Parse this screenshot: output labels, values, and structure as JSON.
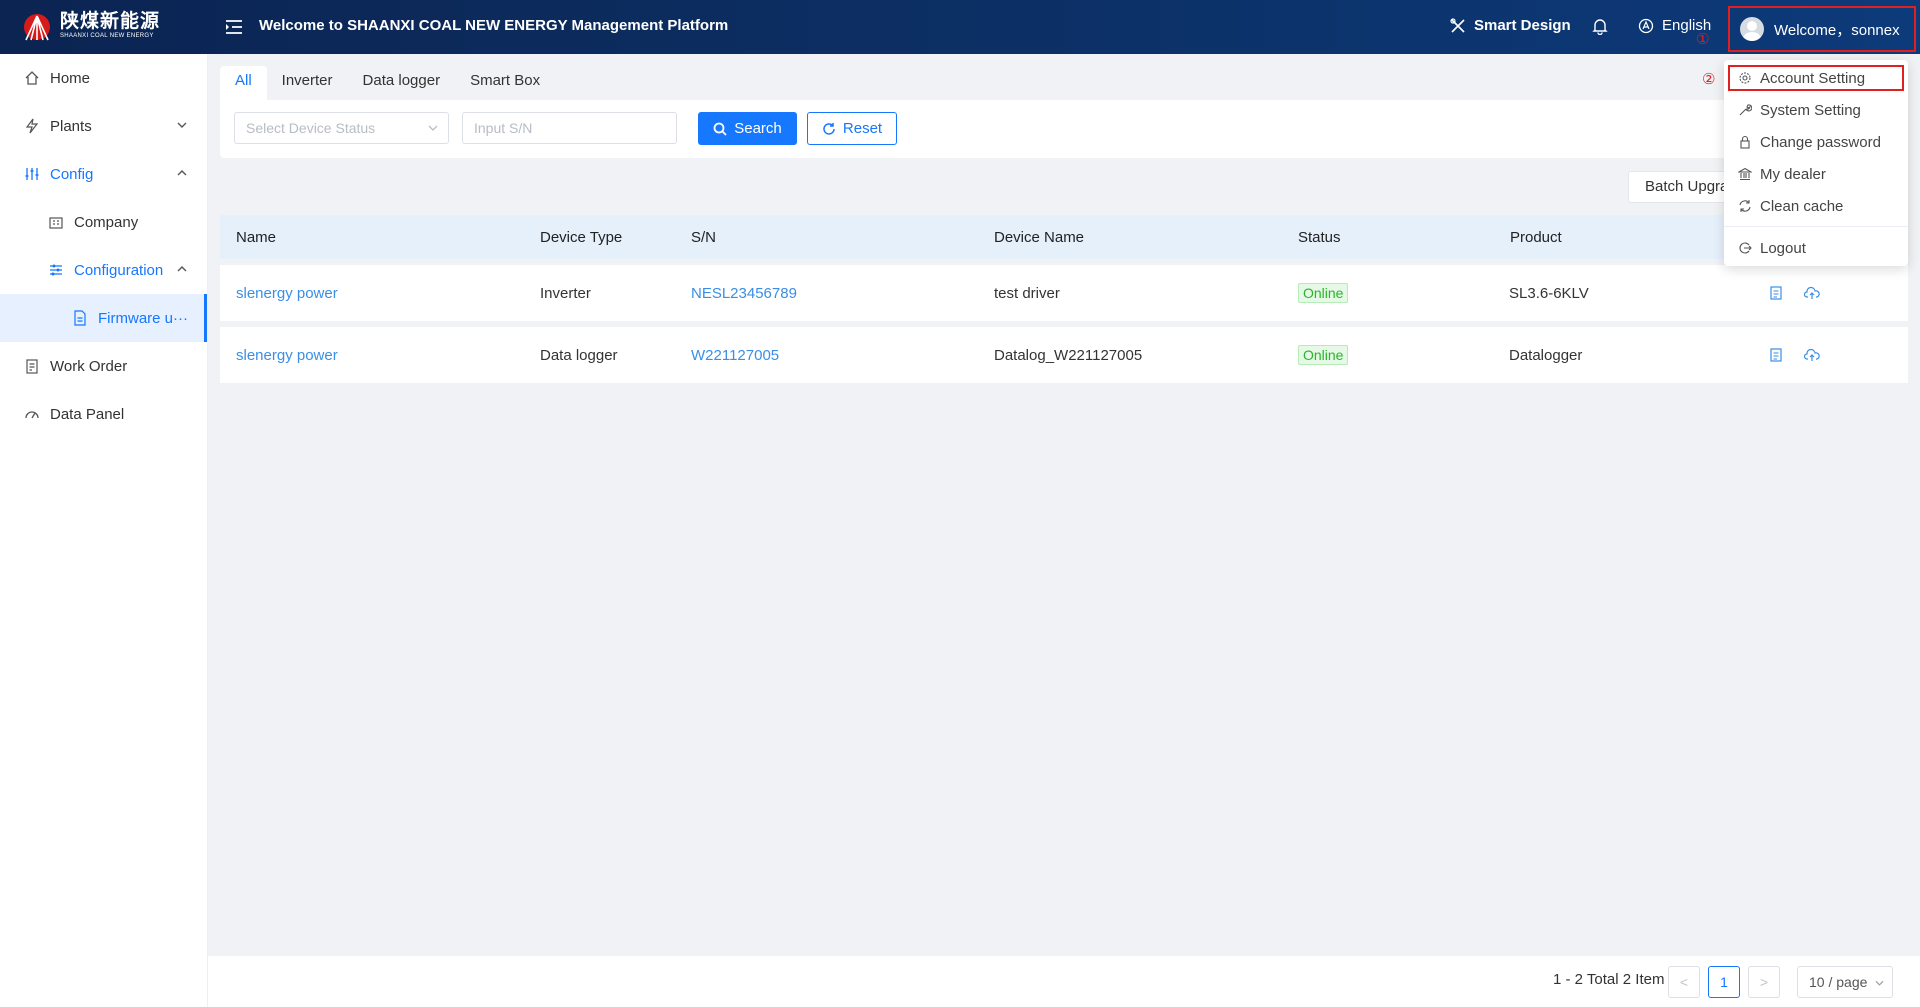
{
  "header": {
    "logo_cn": "陕煤新能源",
    "logo_en": "SHAANXI COAL NEW ENERGY",
    "title": "Welcome to SHAANXI COAL NEW ENERGY Management Platform",
    "smart_design": "Smart Design",
    "language": "English",
    "welcome": "Welcome，sonnex",
    "step1": "①",
    "step2": "②"
  },
  "sidebar": {
    "items": [
      {
        "label": "Home",
        "icon": "home-icon"
      },
      {
        "label": "Plants",
        "icon": "lightning-icon"
      },
      {
        "label": "Config",
        "icon": "sliders-icon"
      },
      {
        "label": "Company",
        "icon": "building-icon"
      },
      {
        "label": "Configuration",
        "icon": "sliders-icon"
      },
      {
        "label": "Firmware u···",
        "icon": "document-icon"
      },
      {
        "label": "Work Order",
        "icon": "clipboard-icon"
      },
      {
        "label": "Data Panel",
        "icon": "gauge-icon"
      }
    ]
  },
  "tabs": [
    "All",
    "Inverter",
    "Data logger",
    "Smart Box"
  ],
  "filter": {
    "status_placeholder": "Select Device Status",
    "sn_placeholder": "Input S/N",
    "search": "Search",
    "reset": "Reset"
  },
  "batch_upgrade": "Batch Upgra",
  "table": {
    "headers": [
      "Name",
      "Device Type",
      "S/N",
      "Device Name",
      "Status",
      "Product"
    ],
    "rows": [
      {
        "name": "slenergy power",
        "type": "Inverter",
        "sn": "NESL23456789",
        "device_name": "test driver",
        "status": "Online",
        "product": "SL3.6-6KLV"
      },
      {
        "name": "slenergy power",
        "type": "Data logger",
        "sn": "W221127005",
        "device_name": "Datalog_W221127005",
        "status": "Online",
        "product": "Datalogger"
      }
    ]
  },
  "dropdown": {
    "items": [
      "Account Setting",
      "System Setting",
      "Change password",
      "My dealer",
      "Clean cache",
      "Logout"
    ]
  },
  "pagination": {
    "total": "1 - 2 Total 2 Item",
    "prev": "<",
    "current": "1",
    "next": ">",
    "page_size": "10 / page"
  },
  "colors": {
    "primary": "#1677ff",
    "header_bg": "#0b2452",
    "online": "#28b528",
    "highlight": "#e02020"
  }
}
